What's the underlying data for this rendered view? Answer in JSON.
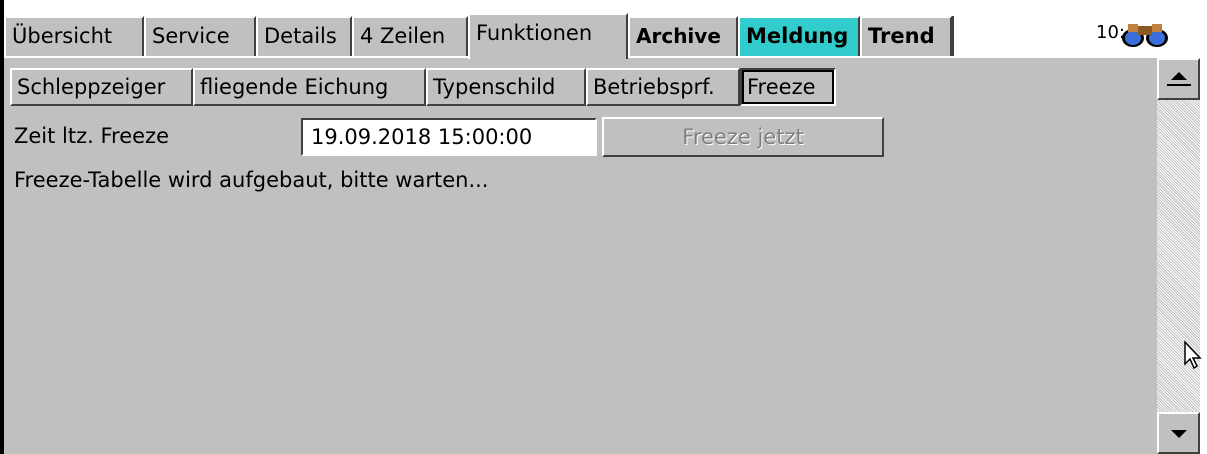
{
  "tabs": [
    {
      "label": "Übersicht"
    },
    {
      "label": "Service"
    },
    {
      "label": "Details"
    },
    {
      "label": "4 Zeilen"
    },
    {
      "label": "Funktionen"
    },
    {
      "label": "Archive"
    },
    {
      "label": "Meldung"
    },
    {
      "label": "Trend"
    },
    {
      "label": ""
    }
  ],
  "clock": "10:",
  "sub_buttons": [
    {
      "label": "Schleppzeiger"
    },
    {
      "label": "fliegende Eichung"
    },
    {
      "label": "Typenschild"
    },
    {
      "label": "Betriebsprf."
    },
    {
      "label": "Freeze"
    }
  ],
  "freeze": {
    "time_label": "Zeit ltz. Freeze",
    "time_value": "19.09.2018 15:00:00",
    "freeze_now_label": "Freeze jetzt",
    "status_text": "Freeze-Tabelle wird aufgebaut, bitte warten..."
  },
  "colors": {
    "panel_bg": "#c0c0c0",
    "highlight_tab": "#33cccc"
  },
  "icons": {
    "binoculars": "binoculars-icon",
    "scroll_up": "arrow-up-icon",
    "scroll_down": "arrow-down-icon",
    "cursor": "mouse-pointer-icon"
  }
}
